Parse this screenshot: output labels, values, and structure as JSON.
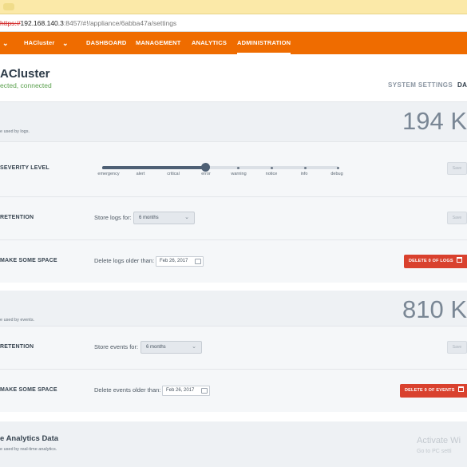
{
  "browser": {
    "url_scheme": "https://",
    "url_host": "192.168.140.3",
    "url_path": ":8457/#!/appliance/6abba47a/settings"
  },
  "nav": {
    "cluster_label": "HACluster",
    "items": [
      "DASHBOARD",
      "MANAGEMENT",
      "ANALYTICS",
      "ADMINISTRATION"
    ],
    "active": "ADMINISTRATION"
  },
  "header": {
    "title": "ACluster",
    "status": "ected, connected",
    "tabs": [
      "SYSTEM SETTINGS",
      "DA"
    ],
    "selected_tab": "DA"
  },
  "logs": {
    "usage_caption": "e used by logs.",
    "usage_value": "194 K",
    "severity_label": "SEVERITY LEVEL",
    "severity_levels": [
      "emergency",
      "alert",
      "critical",
      "error",
      "warning",
      "notice",
      "info",
      "debug"
    ],
    "severity_selected": "error",
    "save_label": "Save",
    "retention_label": "RETENTION",
    "retention_prompt": "Store logs for:",
    "retention_value": "6 months",
    "space_label": "MAKE SOME SPACE",
    "delete_prompt": "Delete logs older than:",
    "delete_date": "Feb 26, 2017",
    "delete_button": "DELETE 0 OF LOGS"
  },
  "events": {
    "usage_caption": "e used by events.",
    "usage_value": "810 K",
    "retention_label": "RETENTION",
    "retention_prompt": "Store events for:",
    "retention_value": "6 months",
    "save_label": "Save",
    "space_label": "MAKE SOME SPACE",
    "delete_prompt": "Delete events older than:",
    "delete_date": "Feb 26, 2017",
    "delete_button": "DELETE 0 OF EVENTS"
  },
  "analytics": {
    "heading": "e Analytics Data",
    "caption": "e used by real-time analytics."
  },
  "watermark": {
    "line1": "Activate Wi",
    "line2": "Go to PC setti"
  },
  "colors": {
    "nav_bg": "#ef6c00",
    "danger": "#d9412e",
    "connected": "#5aa04d"
  }
}
